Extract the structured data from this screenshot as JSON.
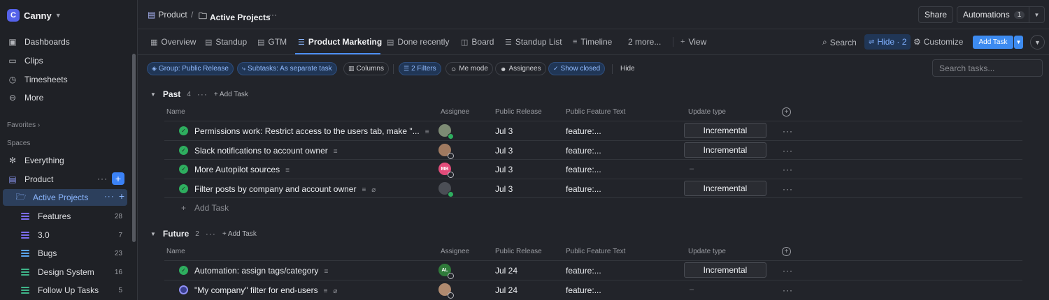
{
  "sidebar": {
    "workspace": "Canny",
    "logo_letter": "C",
    "nav": [
      {
        "label": "Dashboards",
        "icon": "dashboard-icon"
      },
      {
        "label": "Clips",
        "icon": "video-icon"
      },
      {
        "label": "Timesheets",
        "icon": "timer-icon"
      },
      {
        "label": "More",
        "icon": "more-icon"
      }
    ],
    "favorites_label": "Favorites",
    "spaces_label": "Spaces",
    "everything_label": "Everything",
    "product_label": "Product",
    "active_projects_label": "Active Projects",
    "lists": [
      {
        "label": "Features",
        "count": "28",
        "color": "#7c6cf0"
      },
      {
        "label": "3.0",
        "count": "7",
        "color": "#7c6cf0"
      },
      {
        "label": "Bugs",
        "count": "23",
        "color": "#5aa6f0"
      },
      {
        "label": "Design System",
        "count": "16",
        "color": "#3fb58a"
      },
      {
        "label": "Follow Up Tasks",
        "count": "5",
        "color": "#3fb58a"
      }
    ]
  },
  "topbar": {
    "crumb_space": "Product",
    "crumb_sep": "/",
    "crumb_folder": "Active Projects",
    "crumb_dots": "···",
    "share": "Share",
    "automations": "Automations",
    "automations_count": "1"
  },
  "tabs": {
    "items": [
      "Overview",
      "Standup",
      "GTM",
      "Product Marketing",
      "Done recently",
      "Board",
      "Standup List",
      "Timeline",
      "2 more...",
      "View"
    ],
    "search": "Search",
    "hide": "Hide · 2",
    "customize": "Customize",
    "add_task": "Add Task"
  },
  "filters": {
    "group": "Group: Public Release",
    "subtasks": "Subtasks: As separate task",
    "columns": "Columns",
    "filters": "2 Filters",
    "me_mode": "Me mode",
    "assignees": "Assignees",
    "show_closed": "Show closed",
    "hide": "Hide",
    "search_placeholder": "Search tasks..."
  },
  "columns": {
    "name": "Name",
    "assignee": "Assignee",
    "public_release": "Public Release",
    "feature_text": "Public Feature Text",
    "update_type": "Update type"
  },
  "groups": [
    {
      "name": "Past",
      "count": "4",
      "add_label": "Add Task",
      "tasks": [
        {
          "name": "Permissions work: Restrict access to the users tab, make \"...",
          "release": "Jul 3",
          "feature": "feature:...",
          "update": "Incremental",
          "avatar": "",
          "avatar_color": "#7d8b74",
          "status": "done"
        },
        {
          "name": "Slack notifications to account owner",
          "release": "Jul 3",
          "feature": "feature:...",
          "update": "Incremental",
          "avatar": "",
          "avatar_color": "#a07a60",
          "status": "done"
        },
        {
          "name": "More Autopilot sources",
          "release": "Jul 3",
          "feature": "feature:...",
          "update": "–",
          "avatar": "MB",
          "avatar_color": "#e24c7a",
          "status": "done"
        },
        {
          "name": "Filter posts by company and account owner",
          "release": "Jul 3",
          "feature": "feature:...",
          "update": "Incremental",
          "avatar": "",
          "avatar_color": "#4b4e55",
          "status": "done"
        }
      ],
      "add_row": "Add Task"
    },
    {
      "name": "Future",
      "count": "2",
      "add_label": "Add Task",
      "tasks": [
        {
          "name": "Automation: assign tags/category",
          "release": "Jul 24",
          "feature": "feature:...",
          "update": "Incremental",
          "avatar": "AL",
          "avatar_color": "#2f7a3a",
          "status": "done"
        },
        {
          "name": "\"My company\" filter for end-users",
          "release": "Jul 24",
          "feature": "feature:...",
          "update": "–",
          "avatar": "",
          "avatar_color": "#b08a6f",
          "status": "progress"
        }
      ]
    }
  ]
}
